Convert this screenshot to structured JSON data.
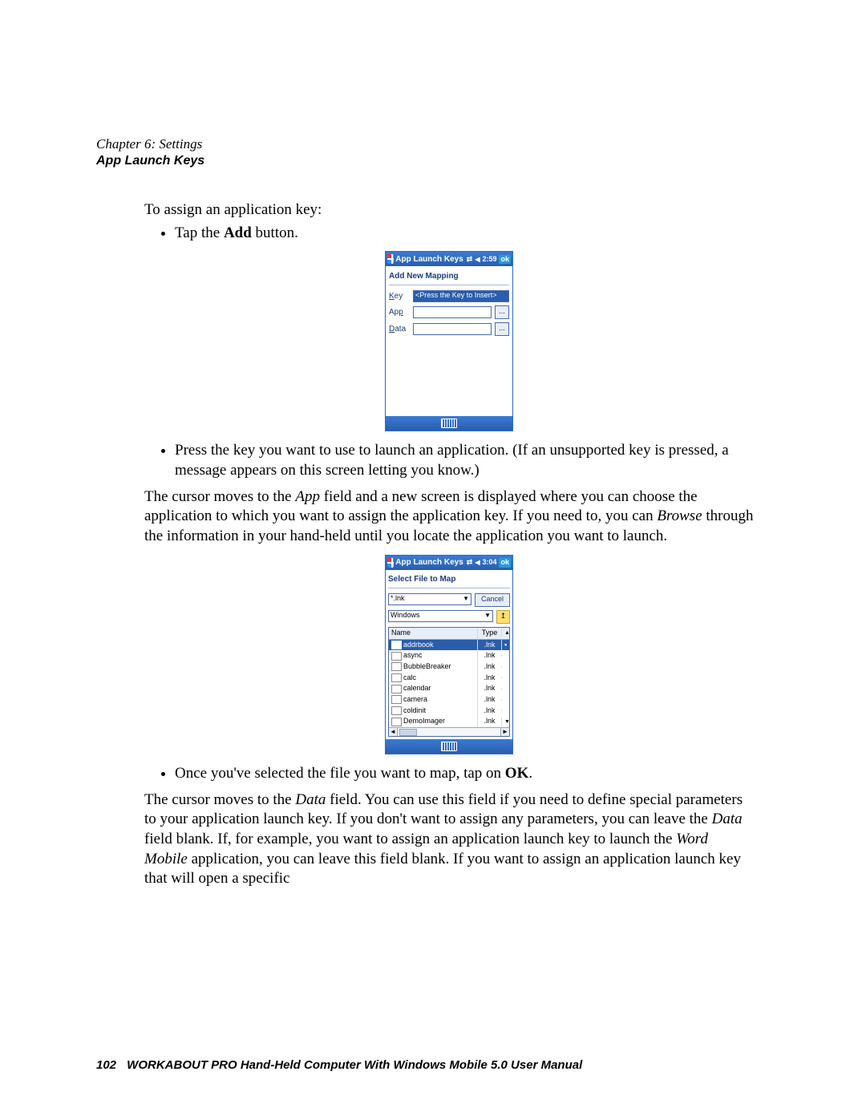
{
  "header": {
    "chapter": "Chapter 6: Settings",
    "section": "App Launch Keys"
  },
  "body": {
    "intro": "To assign an application key:",
    "bullet1_pre": "Tap the ",
    "bullet1_bold": "Add",
    "bullet1_post": " button.",
    "bullet2": "Press the key you want to use to launch an application. (If an unsupported key is pressed, a message appears on this screen letting you know.)",
    "para2_a": "The cursor moves to the ",
    "para2_i1": "App",
    "para2_b": " field and a new screen is displayed where you can choose the application to which you want to assign the application key. If you need to, you can ",
    "para2_i2": "Browse",
    "para2_c": " through the information in your hand-held until you locate the application you want to launch.",
    "bullet3_pre": "Once you've selected the file you want to map, tap on ",
    "bullet3_bold": "OK",
    "bullet3_post": ".",
    "para3_a": "The cursor moves to the ",
    "para3_i1": "Data",
    "para3_b": " field. You can use this field if you need to define special parameters to your application launch key. If you don't want to assign any parameters, you can leave the ",
    "para3_i2": "Data",
    "para3_c": " field blank. If, for example, you want to assign an application launch key to launch the ",
    "para3_i3": "Word Mobile",
    "para3_d": " application, you can leave this field blank. If you want to assign an application launch key that will open a specific"
  },
  "shot1": {
    "title": "App Launch Keys",
    "time": "2:59",
    "ok": "ok",
    "heading": "Add New Mapping",
    "labels": {
      "key": "Key",
      "app": "App",
      "data": "Data"
    },
    "key_value": "<Press the Key to Insert>",
    "browse_label": "..."
  },
  "shot2": {
    "title": "App Launch Keys",
    "time": "3:04",
    "ok": "ok",
    "heading": "Select File to Map",
    "filter": "*.lnk",
    "cancel": "Cancel",
    "folder": "Windows",
    "up_label": "↥",
    "columns": {
      "name": "Name",
      "type": "Type"
    },
    "rows": [
      {
        "name": "addrbook",
        "type": ".lnk",
        "selected": true
      },
      {
        "name": "async",
        "type": ".lnk",
        "selected": false
      },
      {
        "name": "BubbleBreaker",
        "type": ".lnk",
        "selected": false
      },
      {
        "name": "calc",
        "type": ".lnk",
        "selected": false
      },
      {
        "name": "calendar",
        "type": ".lnk",
        "selected": false
      },
      {
        "name": "camera",
        "type": ".lnk",
        "selected": false
      },
      {
        "name": "coldinit",
        "type": ".lnk",
        "selected": false
      },
      {
        "name": "DemoImager",
        "type": ".lnk",
        "selected": false
      }
    ]
  },
  "footer": {
    "page": "102",
    "text": "WORKABOUT PRO Hand-Held Computer With Windows Mobile 5.0 User Manual"
  }
}
